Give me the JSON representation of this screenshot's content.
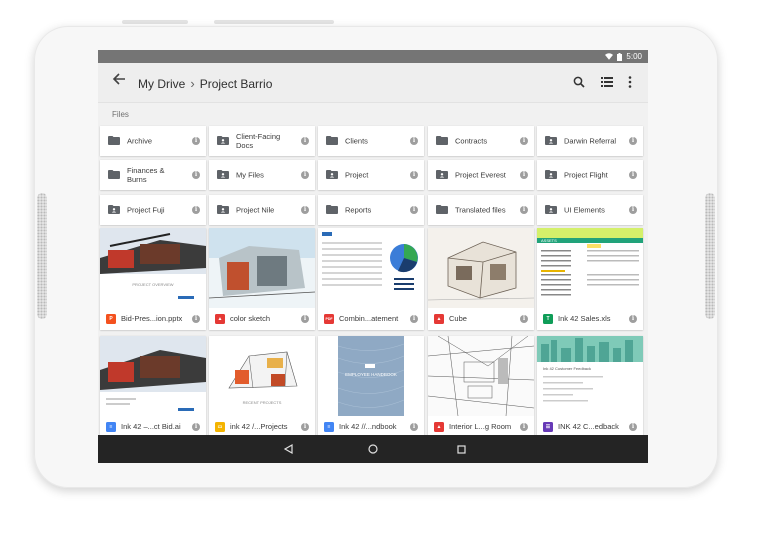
{
  "status_bar": {
    "time": "5:00"
  },
  "app_bar": {
    "breadcrumb_root": "My Drive",
    "breadcrumb_sep": "›",
    "breadcrumb_current": "Project Barrio"
  },
  "section_label": "Files",
  "folders": [
    {
      "label": "Archive",
      "shared": false
    },
    {
      "label": "Client-Facing Docs",
      "shared": true
    },
    {
      "label": "Clients",
      "shared": false
    },
    {
      "label": "Contracts",
      "shared": false
    },
    {
      "label": "Darwin Referral",
      "shared": true
    },
    {
      "label": "Finances & Burns",
      "shared": false
    },
    {
      "label": "My Files",
      "shared": true
    },
    {
      "label": "Project",
      "shared": true
    },
    {
      "label": "Project Everest",
      "shared": true
    },
    {
      "label": "Project Flight",
      "shared": true
    },
    {
      "label": "Project Fuji",
      "shared": true
    },
    {
      "label": "Project Nile",
      "shared": true
    },
    {
      "label": "Reports",
      "shared": false
    },
    {
      "label": "Translated files",
      "shared": false
    },
    {
      "label": "UI Elements",
      "shared": true
    }
  ],
  "files": [
    {
      "name": "Bid-Pres...ion.pptx",
      "type": "slides",
      "badge": "P",
      "color": "#f4511e",
      "thumb_caption": "PROJECT OVERVIEW"
    },
    {
      "name": "color sketch",
      "type": "image",
      "badge": "▲",
      "color": "#e53935",
      "thumb_caption": ""
    },
    {
      "name": "Combin...atement",
      "type": "pdf",
      "badge": "PDF",
      "color": "#e53935",
      "thumb_caption": ""
    },
    {
      "name": "Cube",
      "type": "image",
      "badge": "▲",
      "color": "#e53935",
      "thumb_caption": ""
    },
    {
      "name": "Ink 42 Sales.xls",
      "type": "sheet",
      "badge": "T",
      "color": "#0f9d58",
      "thumb_caption": "ASSETS"
    },
    {
      "name": "Ink 42 –...ct Bid.ai",
      "type": "doc",
      "badge": "≡",
      "color": "#4285f4",
      "thumb_caption": ""
    },
    {
      "name": "ink 42 /...Projects",
      "type": "slides",
      "badge": "▭",
      "color": "#f4b400",
      "thumb_caption": "RECENT PROJECTS"
    },
    {
      "name": "Ink 42 //...ndbook",
      "type": "doc",
      "badge": "≡",
      "color": "#4285f4",
      "thumb_caption": "EMPLOYEE HANDBOOK"
    },
    {
      "name": "Interior L...g Room",
      "type": "image",
      "badge": "▲",
      "color": "#e53935",
      "thumb_caption": ""
    },
    {
      "name": "INK 42 C...edback",
      "type": "form",
      "badge": "☰",
      "color": "#673ab7",
      "thumb_caption": "Ink 42 Customer Feedback"
    }
  ],
  "icons": {
    "back": "arrow-back-icon",
    "search": "search-icon",
    "list_view": "list-view-icon",
    "more": "more-vert-icon",
    "nav_back": "nav-back-icon",
    "nav_home": "nav-home-icon",
    "nav_recents": "nav-recents-icon"
  },
  "colors": {
    "app_bar": "#eeeeee",
    "status_bar": "#757575",
    "nav_bar": "#242424",
    "background": "#f1f1f1"
  }
}
